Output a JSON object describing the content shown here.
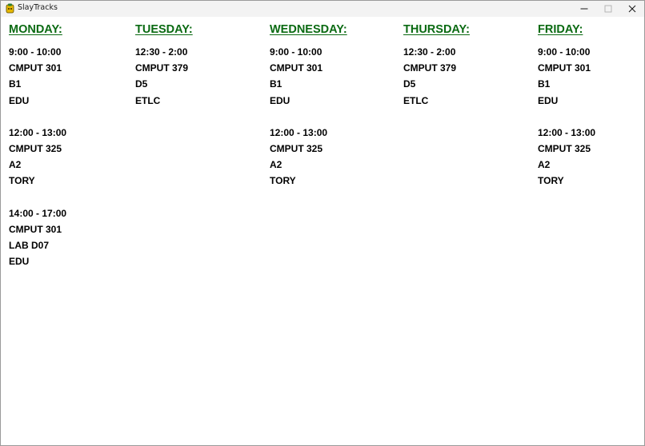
{
  "window": {
    "title": "SlayTracks"
  },
  "titlebar_buttons": {
    "minimize": "minimize",
    "maximize": "maximize",
    "close": "close"
  },
  "colors": {
    "day_header": "#0a6a12",
    "class_text": "#000000",
    "background": "#ffffff"
  },
  "days": [
    {
      "name": "MONDAY:",
      "classes": [
        {
          "time": "9:00 - 10:00",
          "course": "CMPUT 301",
          "section": "B1",
          "building": "EDU"
        },
        {
          "time": "12:00 - 13:00",
          "course": "CMPUT 325",
          "section": "A2",
          "building": "TORY"
        },
        {
          "time": "14:00 - 17:00",
          "course": "CMPUT 301",
          "section": "LAB D07",
          "building": "EDU"
        }
      ]
    },
    {
      "name": "TUESDAY:",
      "classes": [
        {
          "time": "12:30 - 2:00",
          "course": "CMPUT 379",
          "section": "D5",
          "building": "ETLC"
        }
      ]
    },
    {
      "name": "WEDNESDAY:",
      "classes": [
        {
          "time": "9:00 - 10:00",
          "course": "CMPUT 301",
          "section": "B1",
          "building": "EDU"
        },
        {
          "time": "12:00 - 13:00",
          "course": "CMPUT 325",
          "section": "A2",
          "building": "TORY"
        }
      ]
    },
    {
      "name": "THURSDAY:",
      "classes": [
        {
          "time": "12:30 - 2:00",
          "course": "CMPUT 379",
          "section": "D5",
          "building": "ETLC"
        }
      ]
    },
    {
      "name": "FRIDAY:",
      "classes": [
        {
          "time": "9:00 - 10:00",
          "course": "CMPUT 301",
          "section": "B1",
          "building": "EDU"
        },
        {
          "time": "12:00 - 13:00",
          "course": "CMPUT 325",
          "section": "A2",
          "building": "TORY"
        }
      ]
    }
  ]
}
